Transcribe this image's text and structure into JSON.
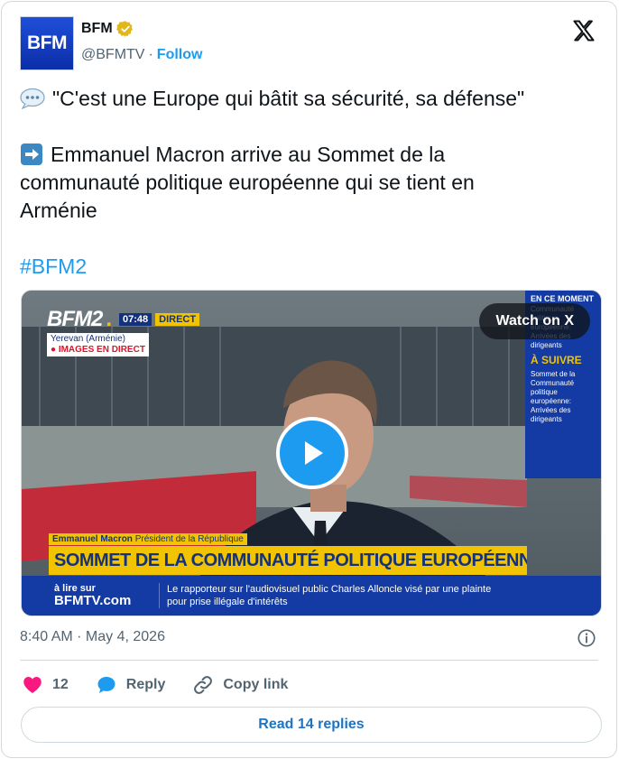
{
  "author": {
    "avatar_text": "BFM",
    "name": "BFM",
    "handle": "@BFMTV",
    "separator": "·",
    "follow_label": "Follow"
  },
  "tweet": {
    "line1": "\"C'est une Europe qui bâtit sa sécurité, sa défense\"",
    "line2": "Emmanuel Macron arrive au Sommet de la",
    "line3": "communauté politique européenne qui se tient en",
    "line4": "Arménie",
    "hashtag": "#BFM2"
  },
  "video": {
    "channel": "BFM2",
    "time": "07:48",
    "direct_label": "DIRECT",
    "location": "Yerevan (Arménie)",
    "live_label": "● IMAGES EN DIRECT",
    "watch_label": "Watch on X",
    "side_header": "EN CE MOMENT",
    "side_now": "Communauté politique européenne: Arrivées des dirigeants",
    "side_next_label": "À SUIVRE",
    "side_next": "Sommet de la Communauté politique européenne: Arrivées des dirigeants",
    "speaker_name": "Emmanuel Macron",
    "speaker_role": "Président de la République",
    "headline": "SOMMET DE LA COMMUNAUTÉ POLITIQUE EUROPÉENNE",
    "ticker_small": "à lire sur",
    "ticker_brand": "BFMTV.com",
    "ticker_line1": "Le rapporteur sur l'audiovisuel public Charles Alloncle visé par une plainte",
    "ticker_line2": "pour prise illégale d'intérêts"
  },
  "meta": {
    "timestamp": "8:40 AM · May 4, 2026"
  },
  "actions": {
    "likes_count": "12",
    "reply_label": "Reply",
    "copy_label": "Copy link",
    "read_replies_label": "Read 14 replies"
  },
  "colors": {
    "accent": "#1d9bf0",
    "like": "#f91880",
    "bfm_blue": "#143ba3",
    "bfm_yellow": "#f2c300"
  }
}
